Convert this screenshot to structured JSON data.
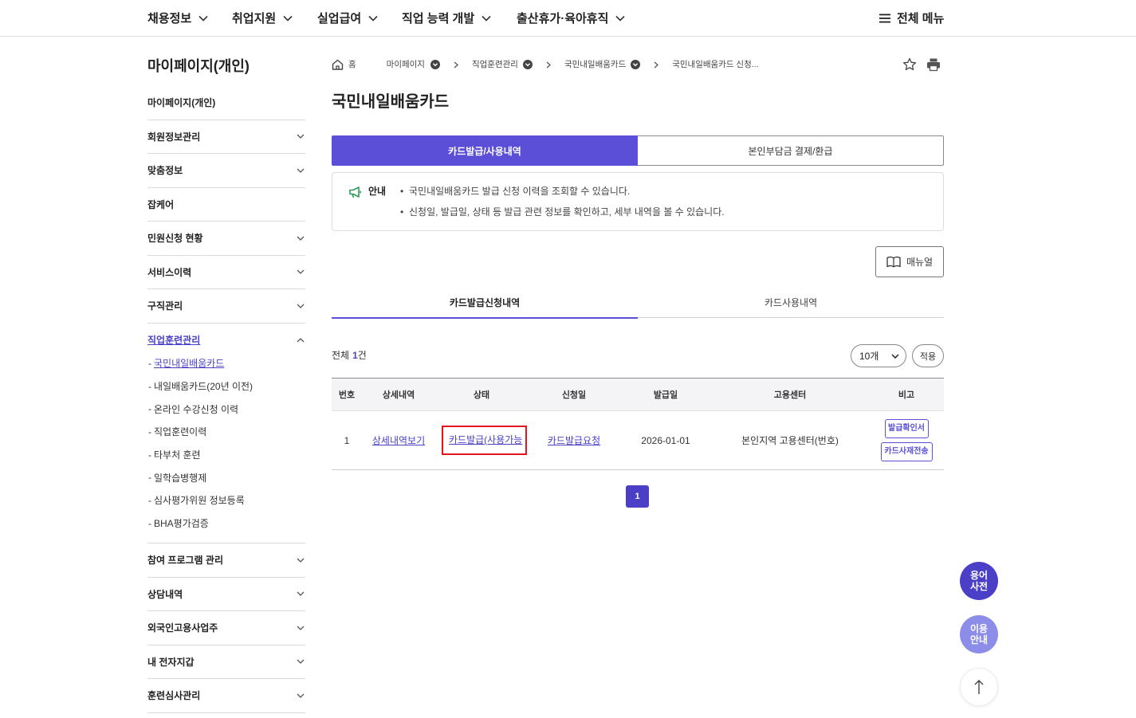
{
  "colors": {
    "primary": "#5a4fd6",
    "primary_dark": "#4a3fc6",
    "link": "#4b42c4",
    "highlight": "#e3141b",
    "notice_icon": "#2f9a5b",
    "guide_button": "#8b8de9"
  },
  "top_nav": {
    "items": [
      {
        "label": "채용정보",
        "icon": "chevron-down-icon"
      },
      {
        "label": "취업지원",
        "icon": "chevron-down-icon"
      },
      {
        "label": "실업급여",
        "icon": "chevron-down-icon"
      },
      {
        "label": "직업 능력 개발",
        "icon": "chevron-down-icon"
      },
      {
        "label": "출산휴가·육아휴직",
        "icon": "chevron-down-icon"
      }
    ],
    "all_menu": {
      "label": "전체 메뉴",
      "icon": "hamburger-icon"
    }
  },
  "sidebar": {
    "title": "마이페이지(개인)",
    "sub_bullet": "-",
    "menu": [
      {
        "label": "마이페이지(개인)",
        "expandable": false
      },
      {
        "label": "회원정보관리",
        "expandable": true
      },
      {
        "label": "맞춤정보",
        "expandable": true
      },
      {
        "label": "잡케어",
        "expandable": false
      },
      {
        "label": "민원신청 현황",
        "expandable": true
      },
      {
        "label": "서비스이력",
        "expandable": true
      },
      {
        "label": "구직관리",
        "expandable": true
      },
      {
        "label": "직업훈련관리",
        "expandable": true,
        "expanded": true,
        "active": true,
        "children": [
          {
            "label": "국민내일배움카드",
            "active": true
          },
          {
            "label": "내일배움카드(20년 이전)"
          },
          {
            "label": "온라인 수강신청 이력"
          },
          {
            "label": "직업훈련이력"
          },
          {
            "label": "타부처 훈련"
          },
          {
            "label": "일학습병행제"
          },
          {
            "label": "심사평가위원 정보등록"
          },
          {
            "label": "BHA평가검증"
          }
        ]
      },
      {
        "label": "참여 프로그램 관리",
        "expandable": true
      },
      {
        "label": "상담내역",
        "expandable": true
      },
      {
        "label": "외국인고용사업주",
        "expandable": true
      },
      {
        "label": "내 전자지갑",
        "expandable": true
      },
      {
        "label": "훈련심사관리",
        "expandable": true
      }
    ]
  },
  "breadcrumb": {
    "items": [
      {
        "label": "홈",
        "icon": "home-icon"
      },
      {
        "label": "마이페이지",
        "icon": "circle-chevron-down-icon"
      },
      {
        "label": "직업훈련관리",
        "icon": "circle-chevron-down-icon"
      },
      {
        "label": "국민내일배움카드",
        "icon": "circle-chevron-down-icon"
      },
      {
        "label": "국민내일배움카드 신청..."
      }
    ],
    "separator_icon": "chevron-right-icon",
    "actions": [
      "star-icon",
      "print-icon"
    ]
  },
  "page_title": "국민내일배움카드",
  "tabs": [
    {
      "label": "카드발급/사용내역",
      "active": true
    },
    {
      "label": "본인부담금 결제/환급",
      "active": false
    }
  ],
  "notice": {
    "icon": "megaphone-icon",
    "label": "안내",
    "bullet": "•",
    "lines": [
      "국민내일배움카드 발급 신청 이력을 조회할 수 있습니다.",
      "신청일, 발급일, 상태 등 발급 관련 정보를 확인하고, 세부 내역을 볼 수 있습니다."
    ]
  },
  "manual_button": {
    "label": "매뉴얼",
    "icon": "book-icon"
  },
  "sub_tabs": [
    {
      "label": "카드발급신청내역",
      "active": true
    },
    {
      "label": "카드사용내역",
      "active": false
    }
  ],
  "list_summary": {
    "prefix": "전체",
    "count": "1",
    "suffix": "건"
  },
  "page_size_select": {
    "selected": "10개",
    "icon": "chevron-down-icon"
  },
  "apply_button": {
    "label": "적용"
  },
  "table": {
    "headers": [
      "번호",
      "상세내역",
      "상태",
      "신청일",
      "발급일",
      "고용센터",
      "비고"
    ],
    "rows": [
      {
        "no": "1",
        "detail": "상세내역보기",
        "status": "카드발급(사용가능",
        "status_highlighted": true,
        "request": "카드발급요청",
        "issue_date": "2026-01-01",
        "center": "본인지역 고용센터(번호)",
        "actions": [
          "발급확인서",
          "카드사재전송"
        ]
      }
    ]
  },
  "pagination": {
    "pages": [
      "1"
    ],
    "current_index": 0
  },
  "floating": {
    "glossary": [
      "용어",
      "사전"
    ],
    "guide": [
      "이용",
      "안내"
    ],
    "top_icon": "arrow-up-icon"
  }
}
